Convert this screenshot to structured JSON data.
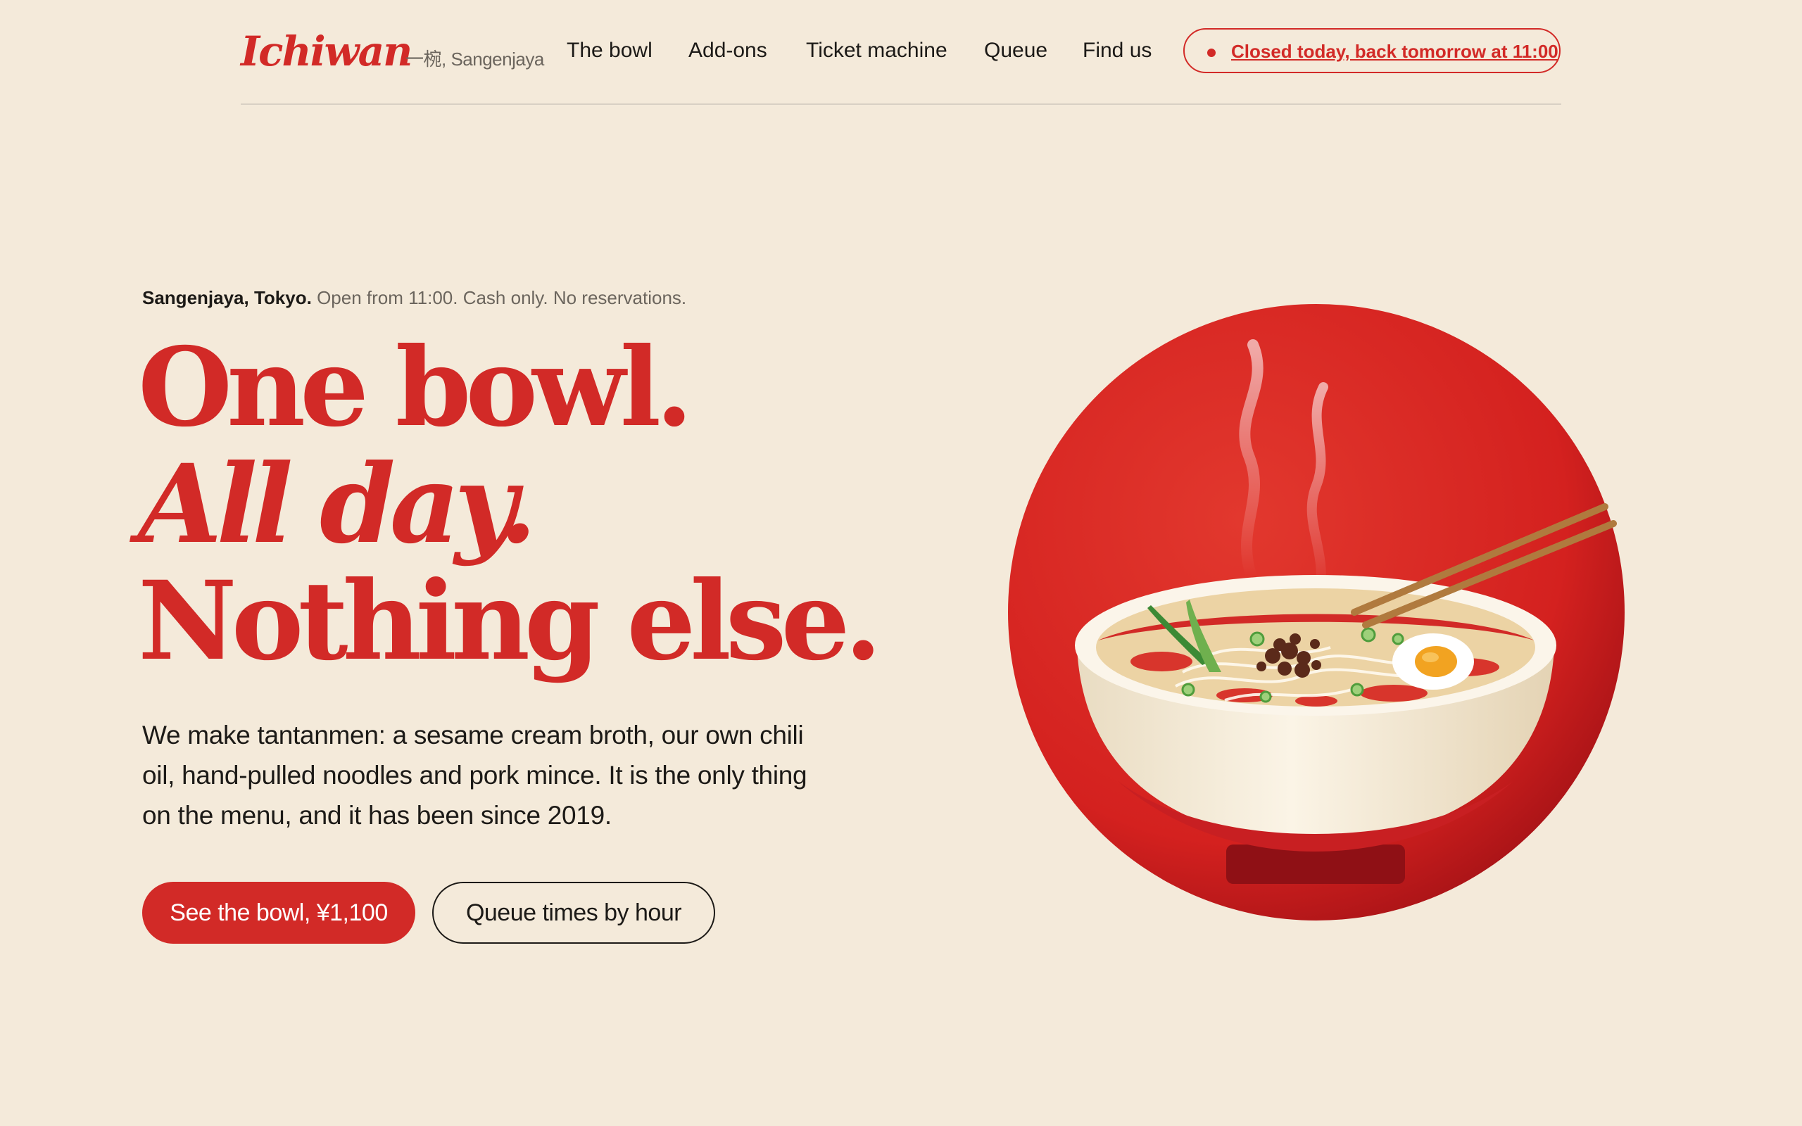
{
  "brand": {
    "logo": "Ichiwan",
    "subtitle": "一椀, Sangenjaya"
  },
  "nav": [
    {
      "label": "The bowl"
    },
    {
      "label": "Add-ons"
    },
    {
      "label": "Ticket machine"
    },
    {
      "label": "Queue"
    },
    {
      "label": "Find us"
    }
  ],
  "status": {
    "label": "Closed today, back tomorrow at 11:00"
  },
  "hero": {
    "location": "Sangenjaya, Tokyo.",
    "details": "Open from 11:00. Cash only. No reservations.",
    "headline": [
      "One bowl.",
      "All day.",
      "Nothing else."
    ],
    "body": "We make tantanmen: a sesame cream broth, our own chili oil, hand-pulled noodles and pork mince. It is the only thing on the menu, and it has been since 2019.",
    "primary_cta": "See the bowl, ¥1,100",
    "secondary_cta": "Queue times by hour"
  },
  "illustration": {
    "name": "ramen-bowl-illustration"
  },
  "colors": {
    "accent": "#d22a27",
    "background": "#f4eada",
    "text": "#1c1a17",
    "muted": "#6b655d"
  }
}
